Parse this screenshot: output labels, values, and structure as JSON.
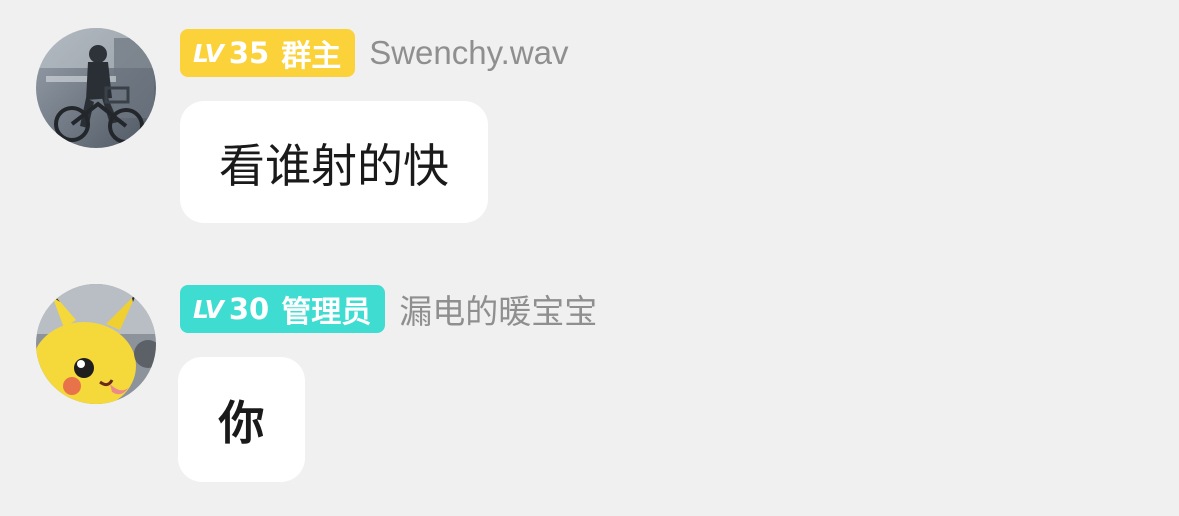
{
  "messages": [
    {
      "avatar": {
        "icon": "user-photo-avatar",
        "colors": [
          "#5d6672",
          "#a9b2bc"
        ]
      },
      "badge": {
        "lv_prefix": "LV",
        "level": "35",
        "role": "群主",
        "color": "#fcd23a"
      },
      "username": "Swenchy.wav",
      "text": "看谁射的快"
    },
    {
      "avatar": {
        "icon": "pikachu-avatar",
        "colors": [
          "#f5d93a",
          "#8a8f95"
        ]
      },
      "badge": {
        "lv_prefix": "LV",
        "level": "30",
        "role": "管理员",
        "color": "#3fdcd2"
      },
      "username": "漏电的暖宝宝",
      "text": "你"
    }
  ]
}
